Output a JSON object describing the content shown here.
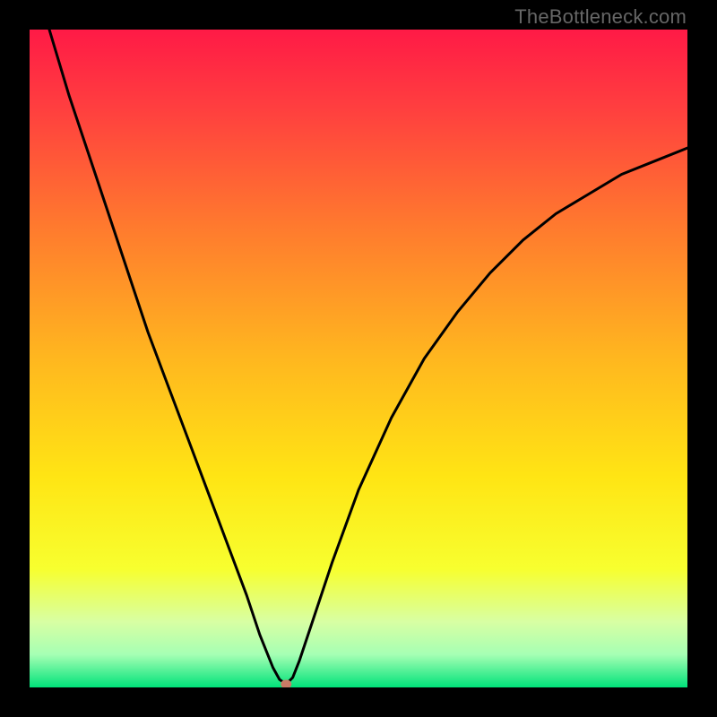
{
  "watermark": "TheBottleneck.com",
  "chart_data": {
    "type": "line",
    "title": "",
    "xlabel": "",
    "ylabel": "",
    "xlim": [
      0,
      100
    ],
    "ylim": [
      0,
      100
    ],
    "grid": false,
    "legend": false,
    "background": "rainbow-gradient-vertical",
    "gradient_stops": [
      {
        "pct": 0,
        "color": "#ff1a46"
      },
      {
        "pct": 12,
        "color": "#ff3f3f"
      },
      {
        "pct": 30,
        "color": "#ff7a2e"
      },
      {
        "pct": 50,
        "color": "#ffb71f"
      },
      {
        "pct": 68,
        "color": "#ffe514"
      },
      {
        "pct": 82,
        "color": "#f7ff2f"
      },
      {
        "pct": 90,
        "color": "#d8ffa3"
      },
      {
        "pct": 95,
        "color": "#a6ffb4"
      },
      {
        "pct": 100,
        "color": "#00e27a"
      }
    ],
    "series": [
      {
        "name": "bottleneck-curve",
        "x": [
          0,
          3,
          6,
          9,
          12,
          15,
          18,
          21,
          24,
          27,
          30,
          33,
          35,
          37,
          38,
          39,
          40,
          41,
          43,
          46,
          50,
          55,
          60,
          65,
          70,
          75,
          80,
          85,
          90,
          95,
          100
        ],
        "y": [
          110,
          100,
          90,
          81,
          72,
          63,
          54,
          46,
          38,
          30,
          22,
          14,
          8,
          3,
          1.2,
          0.5,
          1.5,
          4,
          10,
          19,
          30,
          41,
          50,
          57,
          63,
          68,
          72,
          75,
          78,
          80,
          82
        ]
      }
    ],
    "marker": {
      "x": 39,
      "y": 0.5,
      "color": "#c97b66",
      "rx": 6,
      "ry": 5
    }
  }
}
